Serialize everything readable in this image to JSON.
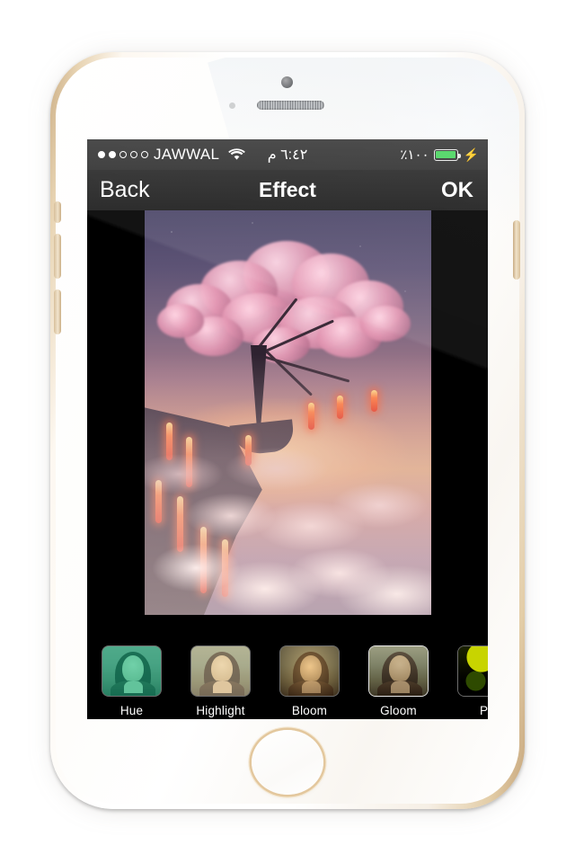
{
  "device": {
    "name": "iphone-gold-white",
    "camera": "front-camera",
    "speaker": "earpiece-speaker",
    "home_button": "home-button"
  },
  "status_bar": {
    "signal_dots_total": 5,
    "signal_dots_filled": 2,
    "carrier": "JAWWAL",
    "wifi_icon": "wifi-icon",
    "time": "٦:٤٢ م",
    "battery_percent": "٪١٠٠",
    "battery_level": 100,
    "charging_icon": "lightning-bolt-icon",
    "battery_color": "#4cd662"
  },
  "nav_bar": {
    "back_label": "Back",
    "title": "Effect",
    "ok_label": "OK"
  },
  "photo": {
    "name": "cherry-blossom-lava-clouds",
    "description": "Cherry blossom tree on a cliff above a sea of clouds with lava flows at sunset"
  },
  "filters": {
    "selected": "Gloom",
    "items": [
      {
        "label": "Hue",
        "tint": "hue",
        "selected": false
      },
      {
        "label": "Highlight",
        "tint": "highlight",
        "selected": false
      },
      {
        "label": "Bloom",
        "tint": "bloom",
        "selected": false
      },
      {
        "label": "Gloom",
        "tint": "gloom",
        "selected": true
      },
      {
        "label": "Po",
        "tint": "posterize",
        "selected": false
      }
    ]
  }
}
